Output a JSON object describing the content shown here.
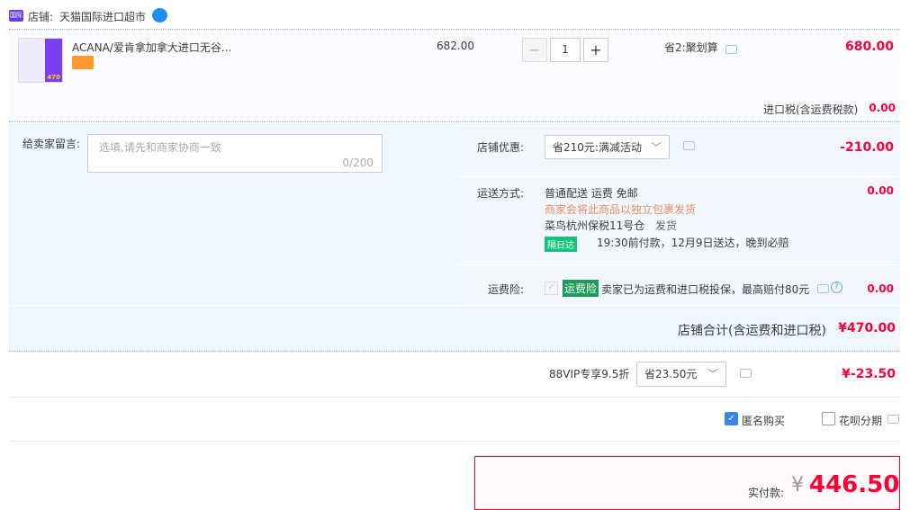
{
  "shop": {
    "label": "店铺:",
    "name": "天猫国际进口超市",
    "badge": "国际"
  },
  "item": {
    "title": "ACANA/爱肯拿加拿大进口无谷...",
    "price": "682.00",
    "quantity": "1",
    "minus": "−",
    "plus": "+",
    "promo": "省2:聚划算",
    "subtotal": "680.00",
    "thumb_price": "470"
  },
  "tax": {
    "label": "进口税(含运费税款)",
    "value": "0.00"
  },
  "message": {
    "label": "给卖家留言:",
    "placeholder": "选填,请先和商家协商一致",
    "counter": "0/200"
  },
  "discount": {
    "label": "店铺优惠:",
    "selected": "省210元:满减活动",
    "value": "-210.00"
  },
  "shipping": {
    "label": "运送方式:",
    "line1": "普通配送 运费 免邮",
    "line2": "商家会将此商品以独立包裹发货",
    "warehouse": "菜鸟杭州保税11号仓",
    "ship": "发货",
    "badge": "隔日达",
    "eta": "19:30前付款，12月9日送达，晚到必赔",
    "value": "0.00"
  },
  "insurance": {
    "label": "运费险:",
    "tag": "运费险",
    "text": "卖家已为运费和进口税投保，最高赔付80元",
    "value": "0.00"
  },
  "shop_total": {
    "label": "店铺合计(含运费和进口税)",
    "value": "¥470.00"
  },
  "vip": {
    "label": "88VIP专享9.5折",
    "selected": "省23.50元",
    "value": "¥-23.50"
  },
  "options": {
    "anonymous": "匿名购买",
    "huabei": "花呗分期"
  },
  "pay": {
    "label": "实付款:",
    "currency": "¥",
    "amount": "446.50"
  }
}
